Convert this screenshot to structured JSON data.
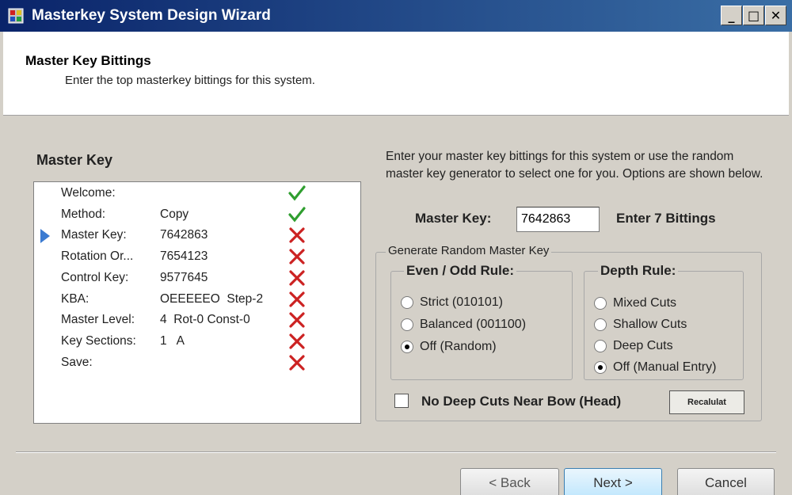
{
  "window": {
    "title": "Masterkey System Design Wizard",
    "icon": "app-icon",
    "controls": {
      "minimize": "_",
      "maximize": "□",
      "close": "✕"
    }
  },
  "header": {
    "title": "Master Key Bittings",
    "subtitle": "Enter the top masterkey bittings for this system."
  },
  "steps_panel": {
    "label": "Master Key",
    "current_index": 2,
    "items": [
      {
        "name": "Welcome:",
        "value": "",
        "status": "check"
      },
      {
        "name": "Method:",
        "value": "Copy",
        "status": "check"
      },
      {
        "name": "Master Key:",
        "value": "7642863",
        "status": "cross"
      },
      {
        "name": "Rotation Or...",
        "value": "7654123",
        "status": "cross"
      },
      {
        "name": "Control Key:",
        "value": "9577645",
        "status": "cross"
      },
      {
        "name": "KBA:",
        "value": "OEEEEEO  Step-2",
        "status": "cross"
      },
      {
        "name": "Master Level:",
        "value": "4  Rot-0 Const-0",
        "status": "cross"
      },
      {
        "name": "Key Sections:",
        "value": "1   A",
        "status": "cross"
      },
      {
        "name": "Save:",
        "value": "",
        "status": "cross"
      }
    ]
  },
  "main": {
    "instructions": "Enter your master key bittings for this system or use the random master key generator to select one for you. Options are shown below.",
    "master_key_label": "Master Key:",
    "master_key_value": "7642863",
    "master_key_hint": "Enter 7 Bittings",
    "generator": {
      "title": "Generate Random Master Key",
      "even_odd": {
        "title": "Even / Odd Rule:",
        "options": [
          {
            "label": "Strict (010101)",
            "selected": false
          },
          {
            "label": "Balanced (001100)",
            "selected": false
          },
          {
            "label": "Off (Random)",
            "selected": true
          }
        ]
      },
      "depth": {
        "title": "Depth Rule:",
        "options": [
          {
            "label": "Mixed Cuts",
            "selected": false
          },
          {
            "label": "Shallow Cuts",
            "selected": false
          },
          {
            "label": "Deep Cuts",
            "selected": false
          },
          {
            "label": "Off (Manual Entry)",
            "selected": true
          }
        ]
      },
      "no_deep_cuts_label": "No Deep Cuts Near Bow (Head)",
      "no_deep_cuts_checked": false,
      "recalc_label": "Recalulat"
    }
  },
  "footer": {
    "back_label": "< Back",
    "next_label": "Next >",
    "cancel_label": "Cancel"
  },
  "colors": {
    "check": "#2f9e2f",
    "cross": "#cc2222",
    "arrow": "#3b7bd1"
  }
}
